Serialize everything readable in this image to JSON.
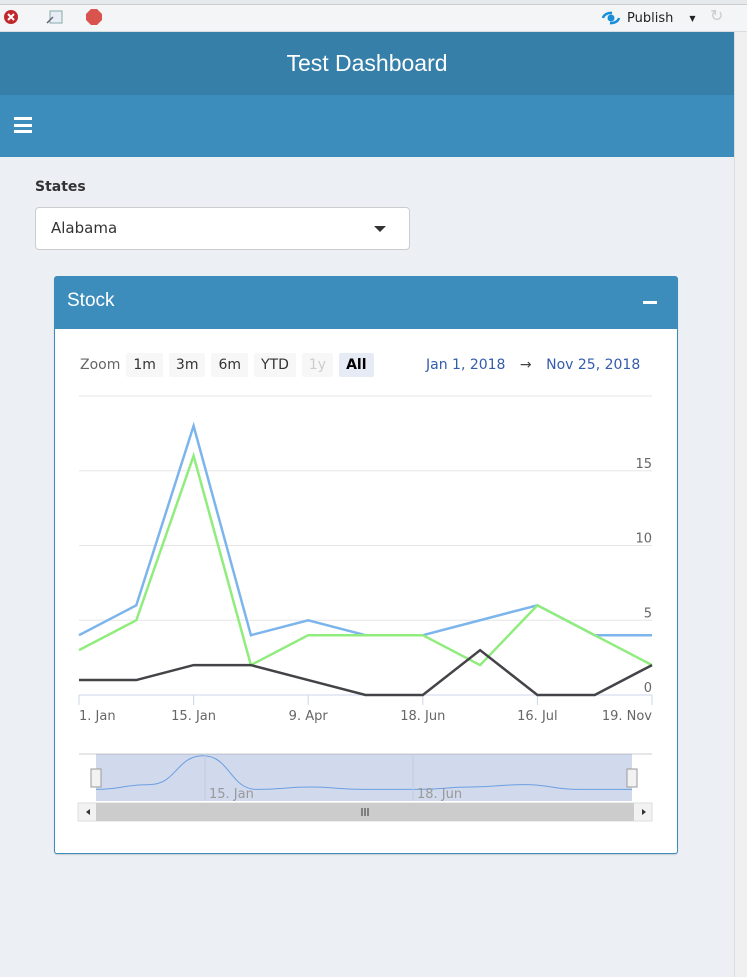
{
  "toolbar": {
    "publish_label": "Publish",
    "icons": [
      "close-icon",
      "popout-icon",
      "stop-icon",
      "publish-icon",
      "refresh-icon"
    ]
  },
  "header": {
    "title": "Test Dashboard"
  },
  "filter": {
    "label": "States",
    "selected": "Alabama"
  },
  "box": {
    "title": "Stock"
  },
  "range_selector": {
    "zoom_label": "Zoom",
    "buttons": [
      "1m",
      "3m",
      "6m",
      "YTD",
      "1y",
      "All"
    ],
    "disabled": "1y",
    "selected": "All",
    "from": "Jan 1, 2018",
    "arrow": "→",
    "to": "Nov 25, 2018"
  },
  "chart_data": {
    "type": "line",
    "x_labels": {
      "0": "1. Jan",
      "2": "15. Jan",
      "4": "9. Apr",
      "6": "18. Jun",
      "8": "16. Jul",
      "10": "19. Nov"
    },
    "ylim": [
      0,
      20
    ],
    "yticks": [
      0,
      5,
      10,
      15
    ],
    "grid": true,
    "colors": [
      "#7cb5ec",
      "#90ed7d",
      "#434348"
    ],
    "series": [
      {
        "values": [
          4,
          6,
          18,
          4,
          5,
          4,
          4,
          5,
          6,
          4,
          4
        ]
      },
      {
        "values": [
          3,
          5,
          16,
          2,
          4,
          4,
          4,
          2,
          6,
          4,
          2
        ]
      },
      {
        "values": [
          1,
          1,
          2,
          2,
          1,
          0,
          0,
          3,
          0,
          0,
          2
        ]
      }
    ],
    "navigator_labels": [
      "15. Jan",
      "18. Jun"
    ]
  }
}
